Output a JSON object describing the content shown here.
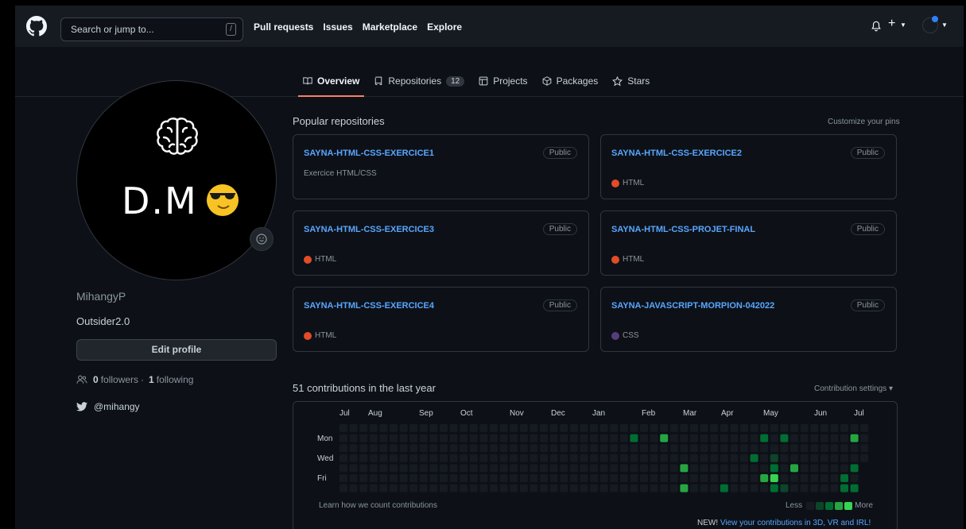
{
  "header": {
    "search_placeholder": "Search or jump to...",
    "search_key": "/",
    "nav": [
      "Pull requests",
      "Issues",
      "Marketplace",
      "Explore"
    ],
    "plus": "+"
  },
  "tabs": [
    {
      "label": "Overview",
      "active": true,
      "icon": "book-icon"
    },
    {
      "label": "Repositories",
      "count": "12",
      "icon": "repo-icon"
    },
    {
      "label": "Projects",
      "icon": "project-icon"
    },
    {
      "label": "Packages",
      "icon": "package-icon"
    },
    {
      "label": "Stars",
      "icon": "star-icon"
    }
  ],
  "profile": {
    "avatar_text": "D.M",
    "username": "MihangyP",
    "bio": "Outsider2.0",
    "edit_button": "Edit profile",
    "followers_count": "0",
    "followers_label": "followers",
    "separator": "·",
    "following_count": "1",
    "following_label": "following",
    "twitter": "@mihangy"
  },
  "pinned": {
    "title": "Popular repositories",
    "customize": "Customize your pins",
    "repos": [
      {
        "name": "SAYNA-HTML-CSS-EXERCICE1",
        "badge": "Public",
        "desc": "Exercice HTML/CSS",
        "lang": "",
        "lang_color": ""
      },
      {
        "name": "SAYNA-HTML-CSS-EXERCICE2",
        "badge": "Public",
        "desc": "",
        "lang": "HTML",
        "lang_color": "#e34c26"
      },
      {
        "name": "SAYNA-HTML-CSS-EXERCICE3",
        "badge": "Public",
        "desc": "",
        "lang": "HTML",
        "lang_color": "#e34c26"
      },
      {
        "name": "SAYNA-HTML-CSS-PROJET-FINAL",
        "badge": "Public",
        "desc": "",
        "lang": "HTML",
        "lang_color": "#e34c26"
      },
      {
        "name": "SAYNA-HTML-CSS-EXERCICE4",
        "badge": "Public",
        "desc": "",
        "lang": "HTML",
        "lang_color": "#e34c26"
      },
      {
        "name": "SAYNA-JAVASCRIPT-MORPION-042022",
        "badge": "Public",
        "desc": "",
        "lang": "CSS",
        "lang_color": "#563d7c"
      }
    ]
  },
  "contributions": {
    "title": "51 contributions in the last year",
    "settings": "Contribution settings ▾",
    "months": [
      "Jul",
      "Aug",
      "Sep",
      "Oct",
      "Nov",
      "Dec",
      "Jan",
      "Feb",
      "Mar",
      "Apr",
      "May",
      "Jun",
      "Jul"
    ],
    "days": [
      "Mon",
      "Wed",
      "Fri"
    ],
    "learn": "Learn how we count contributions",
    "less": "Less",
    "more": "More",
    "new_label": "NEW!",
    "new_link": "View your contributions in 3D, VR and IRL!",
    "weeks": 53,
    "active_cells": [
      {
        "week": 29,
        "day": 1,
        "level": 2
      },
      {
        "week": 32,
        "day": 1,
        "level": 3
      },
      {
        "week": 34,
        "day": 4,
        "level": 3
      },
      {
        "week": 34,
        "day": 6,
        "level": 3
      },
      {
        "week": 35,
        "day": 7,
        "level": 4
      },
      {
        "week": 38,
        "day": 6,
        "level": 2
      },
      {
        "week": 41,
        "day": 3,
        "level": 2
      },
      {
        "week": 42,
        "day": 1,
        "level": 2
      },
      {
        "week": 42,
        "day": 5,
        "level": 3
      },
      {
        "week": 42,
        "day": 7,
        "level": 4
      },
      {
        "week": 43,
        "day": 3,
        "level": 1
      },
      {
        "week": 43,
        "day": 4,
        "level": 2
      },
      {
        "week": 43,
        "day": 5,
        "level": 4
      },
      {
        "week": 43,
        "day": 6,
        "level": 2
      },
      {
        "week": 43,
        "day": 7,
        "level": 4
      },
      {
        "week": 44,
        "day": 1,
        "level": 2
      },
      {
        "week": 44,
        "day": 6,
        "level": 1
      },
      {
        "week": 45,
        "day": 4,
        "level": 3
      },
      {
        "week": 50,
        "day": 5,
        "level": 2
      },
      {
        "week": 50,
        "day": 6,
        "level": 2
      },
      {
        "week": 50,
        "day": 7,
        "level": 4
      },
      {
        "week": 51,
        "day": 1,
        "level": 3
      },
      {
        "week": 51,
        "day": 4,
        "level": 2
      },
      {
        "week": 51,
        "day": 6,
        "level": 2
      }
    ]
  },
  "colors": {
    "level0": "#161b22",
    "level1": "#0e4429",
    "level2": "#006d32",
    "level3": "#26a641",
    "level4": "#39d353"
  }
}
